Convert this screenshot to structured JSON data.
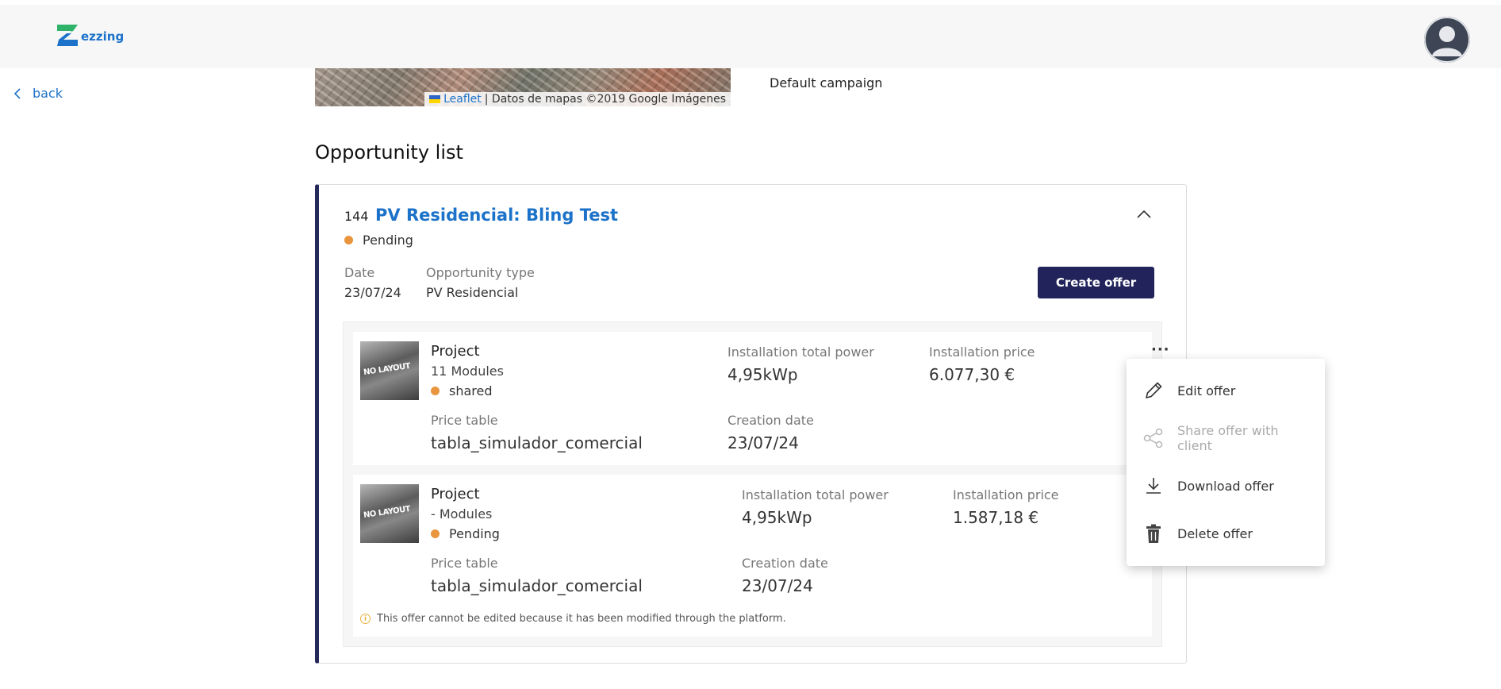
{
  "header": {
    "logo_text": "ezzing",
    "brand_colors": {
      "green": "#2fb36a",
      "blue": "#1c72c9"
    }
  },
  "nav": {
    "back_label": "back"
  },
  "map": {
    "attribution_leaflet": "Leaflet",
    "attribution_rest": "| Datos de mapas ©2019 Google Imágenes"
  },
  "campaign": {
    "value": "Default campaign"
  },
  "section": {
    "title": "Opportunity list"
  },
  "opportunity": {
    "id": "144",
    "title": "PV Residencial: Bling Test",
    "status": "Pending",
    "date_label": "Date",
    "date_value": "23/07/24",
    "type_label": "Opportunity type",
    "type_value": "PV Residencial",
    "create_offer_label": "Create offer"
  },
  "offers": [
    {
      "title": "Project",
      "modules": "11 Modules",
      "status": "shared",
      "power_label": "Installation total power",
      "power_value": "4,95kWp",
      "price_label": "Installation price",
      "price_value": "6.077,30 €",
      "table_label": "Price table",
      "table_value": "tabla_simulador_comercial",
      "created_label": "Creation date",
      "created_value": "23/07/24",
      "more_label": "···"
    },
    {
      "title": "Project",
      "modules": "- Modules",
      "status": "Pending",
      "power_label": "Installation total power",
      "power_value": "4,95kWp",
      "price_label": "Installation price",
      "price_value": "1.587,18 €",
      "table_label": "Price table",
      "table_value": "tabla_simulador_comercial",
      "created_label": "Creation date",
      "created_value": "23/07/24",
      "warning": "This offer cannot be edited because it has been modified through the platform."
    }
  ],
  "context_menu": {
    "items": [
      {
        "label": "Edit offer",
        "icon": "pencil-icon",
        "enabled": true
      },
      {
        "label": "Share offer with client",
        "icon": "share-icon",
        "enabled": false
      },
      {
        "label": "Download offer",
        "icon": "download-icon",
        "enabled": true
      },
      {
        "label": "Delete offer",
        "icon": "trash-icon",
        "enabled": true
      }
    ]
  },
  "colors": {
    "accent_navy": "#22235a",
    "status_orange": "#e9953e",
    "link_blue": "#1c72c9"
  }
}
